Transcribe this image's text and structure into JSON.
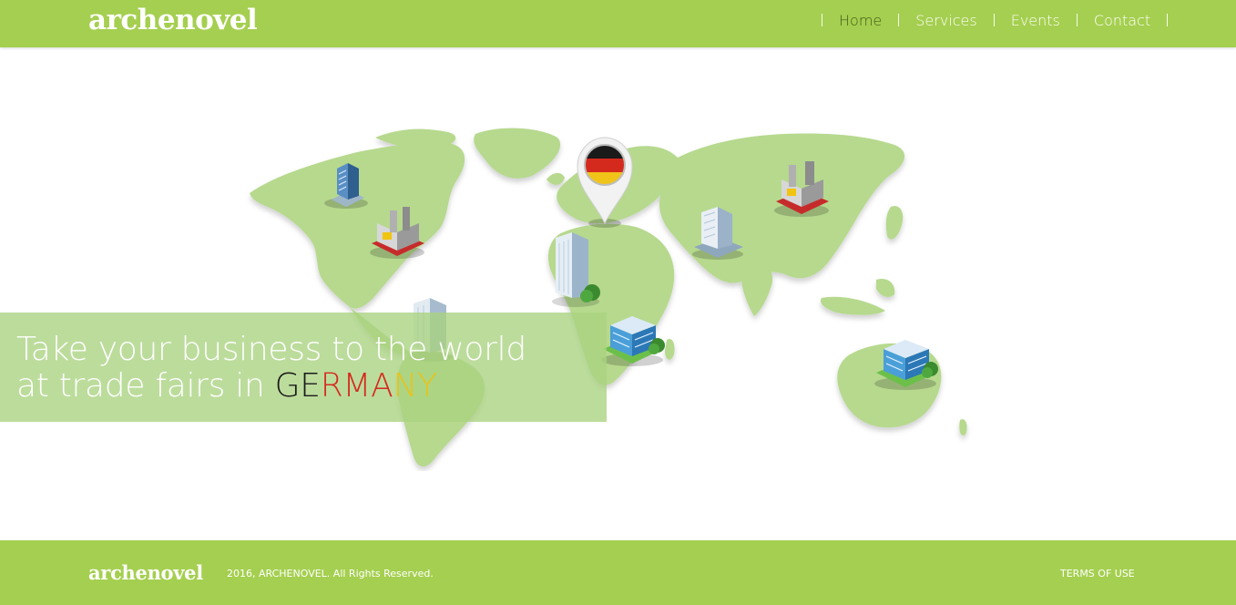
{
  "header": {
    "logo": "archenovel",
    "nav": [
      "Home",
      "Services",
      "Events",
      "Contact"
    ],
    "active": "Home"
  },
  "hero": {
    "line1": "Take your business to the world",
    "line2_prefix": "at trade fairs in",
    "highlight": [
      "GE",
      "RMA",
      "NY"
    ],
    "highlight_colors": [
      "#1a1a1a",
      "#d42a1e",
      "#e8c31c"
    ]
  },
  "map": {
    "icons": [
      "office-building-icon",
      "factory-icon",
      "germany-flag-pin-icon",
      "skyscraper-icon",
      "factory-icon",
      "office-building-icon",
      "office-building-icon",
      "office-building-icon",
      "office-building-icon"
    ]
  },
  "footer": {
    "logo": "archenovel",
    "copyright": "2016, ARCHENOVEL. All Rights Reserved.",
    "terms": "TERMS OF USE"
  },
  "colors": {
    "brand_green": "#a5cf50",
    "map_green": "#b6d98e",
    "nav_active": "#3f5a17"
  }
}
